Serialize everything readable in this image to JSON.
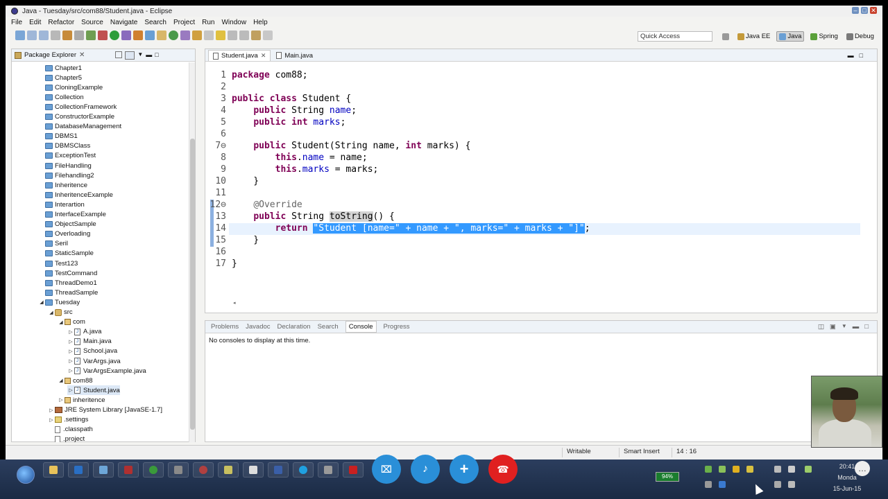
{
  "window": {
    "title": "Java - Tuesday/src/com88/Student.java - Eclipse"
  },
  "menu": [
    "File",
    "Edit",
    "Refactor",
    "Source",
    "Navigate",
    "Search",
    "Project",
    "Run",
    "Window",
    "Help"
  ],
  "toolbar": {
    "quick_access": "Quick Access"
  },
  "perspectives": [
    {
      "label": "Java EE",
      "active": false
    },
    {
      "label": "Java",
      "active": true
    },
    {
      "label": "Spring",
      "active": false
    },
    {
      "label": "Debug",
      "active": false
    }
  ],
  "package_explorer": {
    "title": "Package Explorer",
    "items": [
      {
        "label": "Chapter1",
        "type": "project",
        "depth": 0
      },
      {
        "label": "Chapter5",
        "type": "project",
        "depth": 0
      },
      {
        "label": "CloningExample",
        "type": "project",
        "depth": 0
      },
      {
        "label": "Collection",
        "type": "project",
        "depth": 0
      },
      {
        "label": "CollectionFramework",
        "type": "project",
        "depth": 0
      },
      {
        "label": "ConstructorExample",
        "type": "project",
        "depth": 0
      },
      {
        "label": "DatabaseManagement",
        "type": "project",
        "depth": 0
      },
      {
        "label": "DBMS1",
        "type": "project",
        "depth": 0
      },
      {
        "label": "DBMSClass",
        "type": "project",
        "depth": 0
      },
      {
        "label": "ExceptionTest",
        "type": "project",
        "depth": 0
      },
      {
        "label": "FileHandling",
        "type": "project",
        "depth": 0
      },
      {
        "label": "Filehandling2",
        "type": "project",
        "depth": 0
      },
      {
        "label": "Inheritence",
        "type": "project",
        "depth": 0
      },
      {
        "label": "InheritenceExample",
        "type": "project",
        "depth": 0
      },
      {
        "label": "Interartion",
        "type": "project",
        "depth": 0
      },
      {
        "label": "InterfaceExample",
        "type": "project",
        "depth": 0
      },
      {
        "label": "ObjectSample",
        "type": "project",
        "depth": 0
      },
      {
        "label": "Overloading",
        "type": "project",
        "depth": 0
      },
      {
        "label": "Seril",
        "type": "project",
        "depth": 0
      },
      {
        "label": "StaticSample",
        "type": "project",
        "depth": 0
      },
      {
        "label": "Test123",
        "type": "project",
        "depth": 0
      },
      {
        "label": "TestCommand",
        "type": "project",
        "depth": 0
      },
      {
        "label": "ThreadDemo1",
        "type": "project",
        "depth": 0
      },
      {
        "label": "ThreadSample",
        "type": "project",
        "depth": 0
      },
      {
        "label": "Tuesday",
        "type": "project",
        "depth": 0,
        "expanded": true
      },
      {
        "label": "src",
        "type": "src",
        "depth": 1,
        "expanded": true
      },
      {
        "label": "com",
        "type": "package",
        "depth": 2,
        "expanded": true
      },
      {
        "label": "A.java",
        "type": "java",
        "depth": 3
      },
      {
        "label": "Main.java",
        "type": "java",
        "depth": 3
      },
      {
        "label": "School.java",
        "type": "java",
        "depth": 3
      },
      {
        "label": "VarArgs.java",
        "type": "java",
        "depth": 3
      },
      {
        "label": "VarArgsExample.java",
        "type": "java",
        "depth": 3
      },
      {
        "label": "com88",
        "type": "package",
        "depth": 2,
        "expanded": true
      },
      {
        "label": "Student.java",
        "type": "java",
        "depth": 3,
        "selected": true
      },
      {
        "label": "inheritence",
        "type": "package",
        "depth": 2
      },
      {
        "label": "JRE System Library [JavaSE-1.7]",
        "type": "lib",
        "depth": 1
      },
      {
        "label": ".settings",
        "type": "plainfolder",
        "depth": 1
      },
      {
        "label": ".classpath",
        "type": "file",
        "depth": 1
      },
      {
        "label": ".project",
        "type": "file",
        "depth": 1
      }
    ]
  },
  "editor": {
    "tabs": [
      {
        "label": "Student.java",
        "active": true
      },
      {
        "label": "Main.java",
        "active": false
      }
    ]
  },
  "console": {
    "tabs": [
      "Problems",
      "Javadoc",
      "Declaration",
      "Search",
      "Console",
      "Progress"
    ],
    "active": "Console",
    "message": "No consoles to display at this time."
  },
  "status": {
    "writable": "Writable",
    "insert_mode": "Smart Insert",
    "position": "14 : 16"
  },
  "tray": {
    "battery": "94%",
    "time": "20:41",
    "day": "Monda",
    "date": "15-Jun-15"
  }
}
